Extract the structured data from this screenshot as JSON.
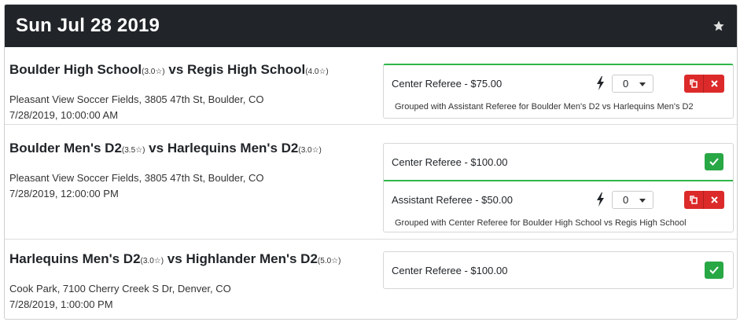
{
  "header": {
    "date": "Sun Jul 28 2019",
    "favorite_icon": "star-icon"
  },
  "games": [
    {
      "home": "Boulder High School",
      "home_rating": "(3.0",
      "vs": "vs",
      "away": "Regis High School",
      "away_rating": "(4.0",
      "location": "Pleasant View Soccer Fields, 3805 47th St, Boulder, CO",
      "datetime": "7/28/2019, 10:00:00 AM",
      "slots": [
        {
          "label": "Center Referee - $75.00",
          "count": "0",
          "grouped": "Grouped with Assistant Referee for Boulder Men's D2 vs Harlequins Men's D2"
        }
      ]
    },
    {
      "home": "Boulder Men's D2",
      "home_rating": "(3.5",
      "vs": "vs",
      "away": "Harlequins Men's D2",
      "away_rating": "(3.0",
      "location": "Pleasant View Soccer Fields, 3805 47th St, Boulder, CO",
      "datetime": "7/28/2019, 12:00:00 PM",
      "slots": [
        {
          "label": "Center Referee - $100.00"
        },
        {
          "label": "Assistant Referee - $50.00",
          "count": "0",
          "grouped": "Grouped with Center Referee for Boulder High School vs Regis High School"
        }
      ]
    },
    {
      "home": "Harlequins Men's D2",
      "home_rating": "(3.0",
      "vs": "vs",
      "away": "Highlander Men's D2",
      "away_rating": "(5.0",
      "location": "Cook Park, 7100 Cherry Creek S Dr, Denver, CO",
      "datetime": "7/28/2019, 1:00:00 PM",
      "slots": [
        {
          "label": "Center Referee - $100.00"
        }
      ]
    }
  ],
  "colors": {
    "header_bg": "#212529",
    "danger": "#dc2a2a",
    "success": "#28a745",
    "grouped_line": "#2eb64a"
  }
}
